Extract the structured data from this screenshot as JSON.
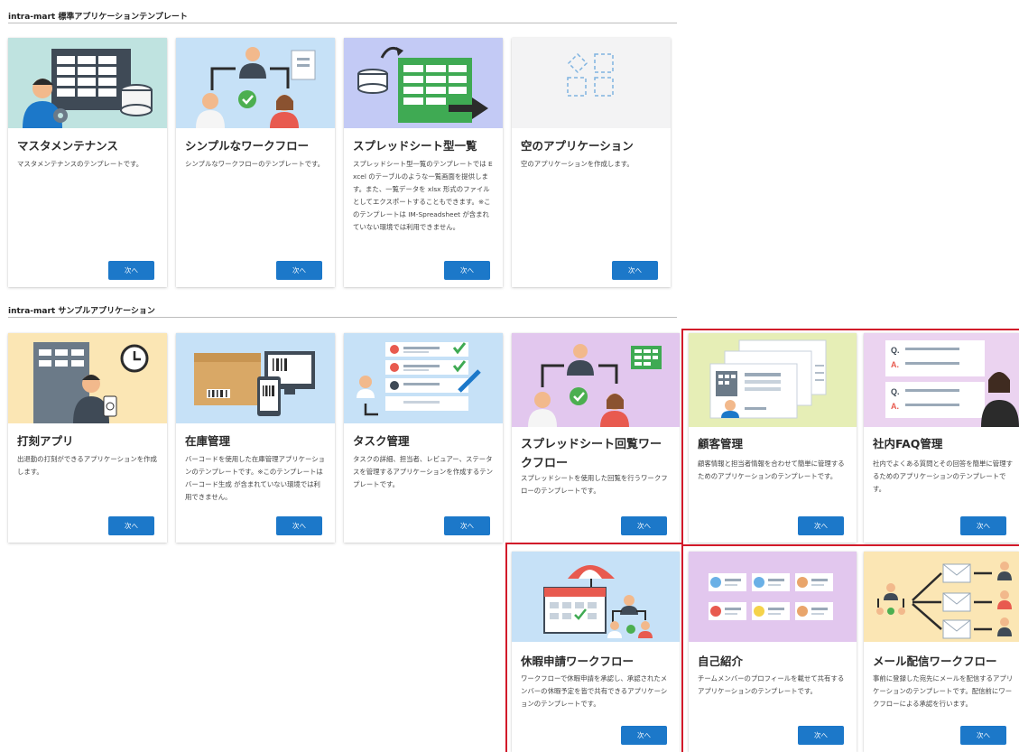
{
  "sections": {
    "standard": "intra-mart 標準アプリケーションテンプレート",
    "sample": "intra-mart サンプルアプリケーション"
  },
  "next_label": "次へ",
  "cards": {
    "master": {
      "title": "マスタメンテナンス",
      "desc": "マスタメンテナンスのテンプレートです。",
      "bg": "#bfe3e0"
    },
    "simple_wf": {
      "title": "シンプルなワークフロー",
      "desc": "シンプルなワークフローのテンプレートです。",
      "bg": "#c6e1f7"
    },
    "spreadsheet": {
      "title": "スプレッドシート型一覧",
      "desc": "スプレッドシート型一覧のテンプレートでは Excel のテーブルのような一覧画面を提供します。また、一覧データを xlsx 形式のファイルとしてエクスポートすることもできます。※このテンプレートは IM-Spreadsheet が含まれていない環境では利用できません。",
      "bg": "#c3caf5"
    },
    "empty": {
      "title": "空のアプリケーション",
      "desc": "空のアプリケーションを作成します。",
      "bg": "#f3f3f4"
    },
    "timecard": {
      "title": "打刻アプリ",
      "desc": "出退勤の打刻ができるアプリケーションを作成します。",
      "bg": "#fbe6b4"
    },
    "inventory": {
      "title": "在庫管理",
      "desc": "バーコードを使用した在庫管理アプリケーションのテンプレートです。※このテンプレートは バーコード生成 が含まれていない環境では利用できません。",
      "bg": "#c6e1f7"
    },
    "task": {
      "title": "タスク管理",
      "desc": "タスクの詳細、担当者、レビュアー、ステータスを管理するアプリケーションを作成するテンプレートです。",
      "bg": "#c6e1f7"
    },
    "sheet_wf": {
      "title": "スプレッドシート回覧ワークフロー",
      "desc": "スプレッドシートを使用した回覧を行うワークフローのテンプレートです。",
      "bg": "#e2c7ee"
    },
    "customer": {
      "title": "顧客管理",
      "desc": "顧客情報と担当者情報を合わせて簡単に管理するためのアプリケーションのテンプレートです。",
      "bg": "#e6eeb6"
    },
    "faq": {
      "title": "社内FAQ管理",
      "desc": "社内でよくある質問とその回答を簡単に管理するためのアプリケーションのテンプレートです。",
      "bg": "#ebd3f0"
    },
    "vacation": {
      "title": "休暇申請ワークフロー",
      "desc": "ワークフローで休暇申請を承認し、承認されたメンバーの休暇予定を皆で共有できるアプリケーションのテンプレートです。",
      "bg": "#c6e1f7"
    },
    "intro": {
      "title": "自己紹介",
      "desc": "チームメンバーのプロフィールを載せて共有するアプリケーションのテンプレートです。",
      "bg": "#e2c7ee"
    },
    "mail_wf": {
      "title": "メール配信ワークフロー",
      "desc": "事前に登録した宛先にメールを配信するアプリケーションのテンプレートです。配信前にワークフローによる承認を行います。",
      "bg": "#fbe6b4"
    }
  },
  "thumb_labels": {
    "faq_q": "Q.",
    "faq_a": "A."
  },
  "colors": {
    "button": "#1c78c9",
    "highlight": "#d21a2a"
  }
}
